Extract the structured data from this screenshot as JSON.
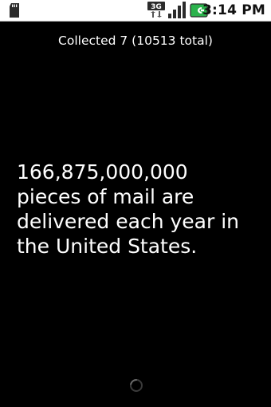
{
  "status_bar": {
    "network_label": "3G",
    "time": "3:14 PM",
    "accent_color": "#2bb24c"
  },
  "header": {
    "counter_text": "Collected 7 (10513 total)"
  },
  "content": {
    "fact_text": "166,875,000,000 pieces of mail are delivered each year in the United States."
  },
  "icons": [
    "sd-card-icon",
    "3g-data-icon",
    "signal-strength-icon",
    "battery-charging-icon",
    "loading-spinner-icon"
  ]
}
